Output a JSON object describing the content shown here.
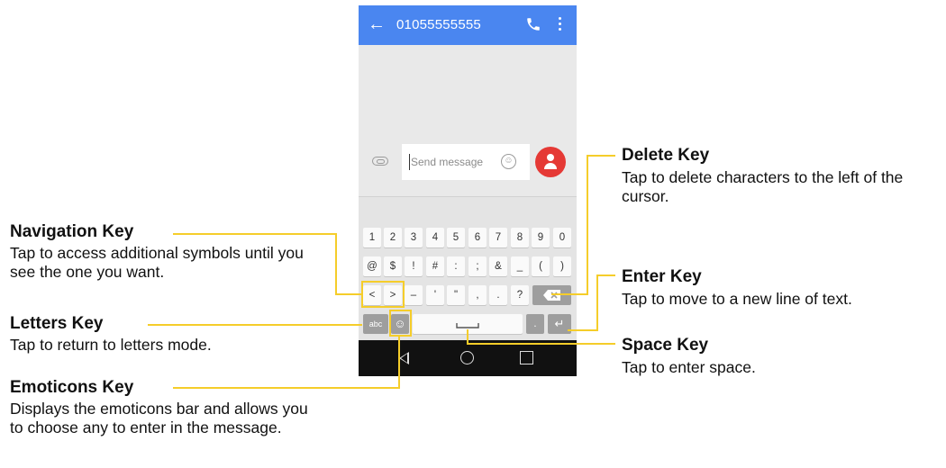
{
  "phone": {
    "appbar": {
      "back_glyph": "←",
      "title": "01055555555",
      "color": "#4a86f0"
    },
    "compose": {
      "placeholder": "Send message",
      "send_color": "#e53935"
    },
    "keyboard": {
      "row1": [
        "1",
        "2",
        "3",
        "4",
        "5",
        "6",
        "7",
        "8",
        "9",
        "0"
      ],
      "row2": [
        "@",
        "$",
        "!",
        "#",
        ":",
        ";",
        "&",
        "_",
        "(",
        ")"
      ],
      "row3": [
        "<",
        ">",
        "–",
        "'",
        "\"",
        ",",
        ".",
        "?"
      ],
      "letters_key": "abc",
      "emoticon_key": "☺",
      "enter_glyph": "↵"
    },
    "navbar": [
      "back-icon",
      "home-icon",
      "recent-apps-icon"
    ]
  },
  "callouts": {
    "delete": {
      "title": "Delete Key",
      "desc": "Tap to delete characters to the left of the cursor."
    },
    "enter": {
      "title": "Enter Key",
      "desc": "Tap to move to a new line of text."
    },
    "space": {
      "title": "Space Key",
      "desc": "Tap to enter space."
    },
    "navigation": {
      "title": "Navigation Key",
      "desc": "Tap to access additional symbols until you see the one you want."
    },
    "letters": {
      "title": "Letters Key",
      "desc": "Tap to return to letters mode."
    },
    "emoticons": {
      "title": "Emoticons Key",
      "desc": "Displays the emoticons bar and allows you to choose any to enter in the message."
    }
  },
  "accent_color": "#f5cd2a"
}
